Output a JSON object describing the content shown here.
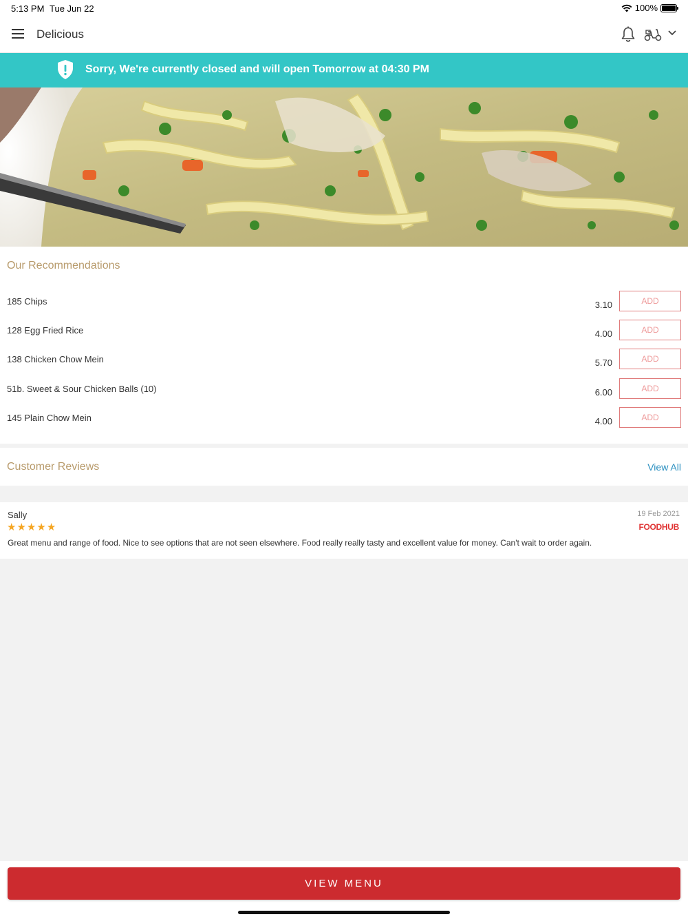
{
  "status_bar": {
    "time": "5:13 PM",
    "date": "Tue Jun 22",
    "battery": "100%"
  },
  "header": {
    "title": "Delicious"
  },
  "banner": {
    "message": "Sorry, We're currently closed and will open Tomorrow at 04:30 PM",
    "color": "#33c6c6"
  },
  "recommendations": {
    "title": "Our Recommendations",
    "add_label": "ADD",
    "items": [
      {
        "name": "185 Chips",
        "price": "3.10"
      },
      {
        "name": "128 Egg Fried Rice",
        "price": "4.00"
      },
      {
        "name": "138 Chicken Chow Mein",
        "price": "5.70"
      },
      {
        "name": "51b. Sweet & Sour Chicken Balls (10)",
        "price": "6.00"
      },
      {
        "name": "145 Plain Chow Mein",
        "price": "4.00"
      }
    ]
  },
  "reviews": {
    "title": "Customer Reviews",
    "view_all": "View All",
    "items": [
      {
        "name": "Sally",
        "rating": 5,
        "date": "19 Feb 2021",
        "source": "FOODHUB",
        "text": "Great menu and range of food.  Nice to see options that are not seen elsewhere.  Food really really tasty and excellent value for money.  Can't wait to order again."
      }
    ]
  },
  "footer": {
    "view_menu": "VIEW MENU",
    "button_color": "#cc2b2f"
  },
  "icons": [
    "menu-icon",
    "bell-icon",
    "scooter-icon",
    "chevron-down-icon",
    "shield-icon",
    "wifi-icon",
    "battery-icon",
    "star-icon"
  ]
}
